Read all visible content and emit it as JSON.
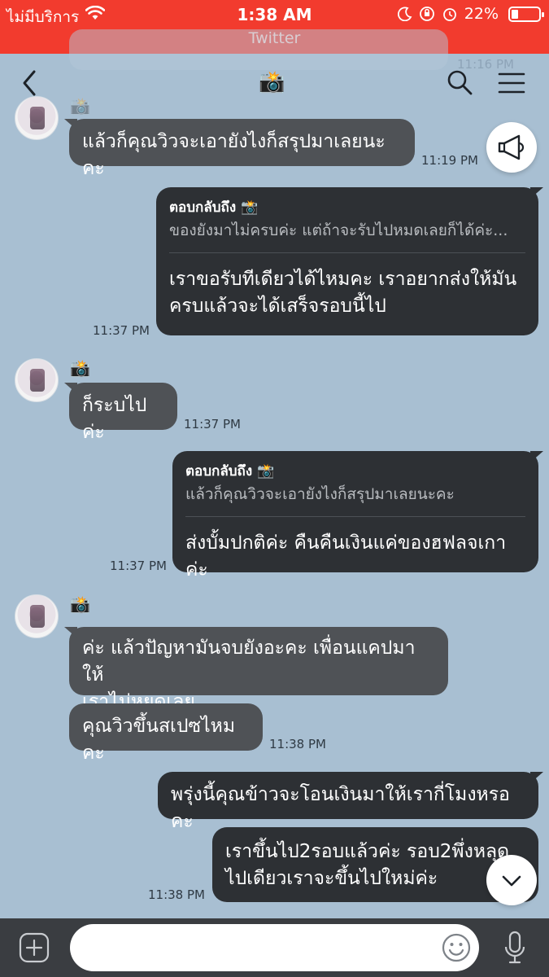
{
  "status_bar": {
    "carrier": "ไม่มีบริการ",
    "time": "1:38 AM",
    "battery": "22%",
    "battery_level": 0.22,
    "back_app": "Twitter"
  },
  "header": {
    "title_icon": "📸",
    "back_icon": "chevron-left-icon",
    "search_icon": "search-icon",
    "menu_icon": "hamburger-menu-icon"
  },
  "ghost": {
    "time": "11:16 PM"
  },
  "messages": [
    {
      "sender": "📸",
      "text": "แล้วก็คุณวิวจะเอายังไงก็สรุปมาเลยนะคะ",
      "time": "11:19 PM"
    },
    {
      "quote_head": "ตอบกลับถึง 📸",
      "quote_text": "ของยังมาไม่ครบค่ะ แต่ถ้าจะรับไปหมดเลยก็ได้ค่ะ...",
      "line1": "เราขอรับทีเดียวได้ไหมคะ เราอยากส่งให้มัน",
      "line2": "ครบแล้วจะได้เสร็จรอบนี้ไป",
      "time": "11:37 PM"
    },
    {
      "sender": "📸",
      "text": "ก็ระบไปค่ะ",
      "time": "11:37 PM"
    },
    {
      "quote_head": "ตอบกลับถึง 📸",
      "quote_text": "แล้วก็คุณวิวจะเอายังไงก็สรุปมาเลยนะคะ",
      "text": "ส่งบั้มปกติค่ะ คืนคืนเงินแค่ของฮฟลจเกาค่ะ",
      "time": "11:37 PM"
    },
    {
      "sender": "📸",
      "line1": "ค่ะ แล้วปัญหามันจบยังอะคะ เพื่อนแคปมาให้",
      "line2": "เราไม่หยุดเลย"
    },
    {
      "text": "คุณวิวขึ้นสเปซไหมคะ",
      "time": "11:38 PM"
    },
    {
      "text": "พรุ่งนี้คุณข้าวจะโอนเงินมาให้เรากี่โมงหรอคะ"
    },
    {
      "line1": "เราขึ้นไป2รอบแล้วค่ะ รอบ2พึ่งหลุด",
      "line2": "ไปเดียวเราจะขึ้นไปใหม่ค่ะ",
      "time": "11:38 PM"
    }
  ],
  "input": {
    "placeholder": ""
  },
  "colors": {
    "status_bar": "#f23b2e",
    "background": "#a8bfd2",
    "bubble_in": "#4f5256",
    "bubble_out": "#2d3034",
    "input_bar": "#3a3d41"
  }
}
